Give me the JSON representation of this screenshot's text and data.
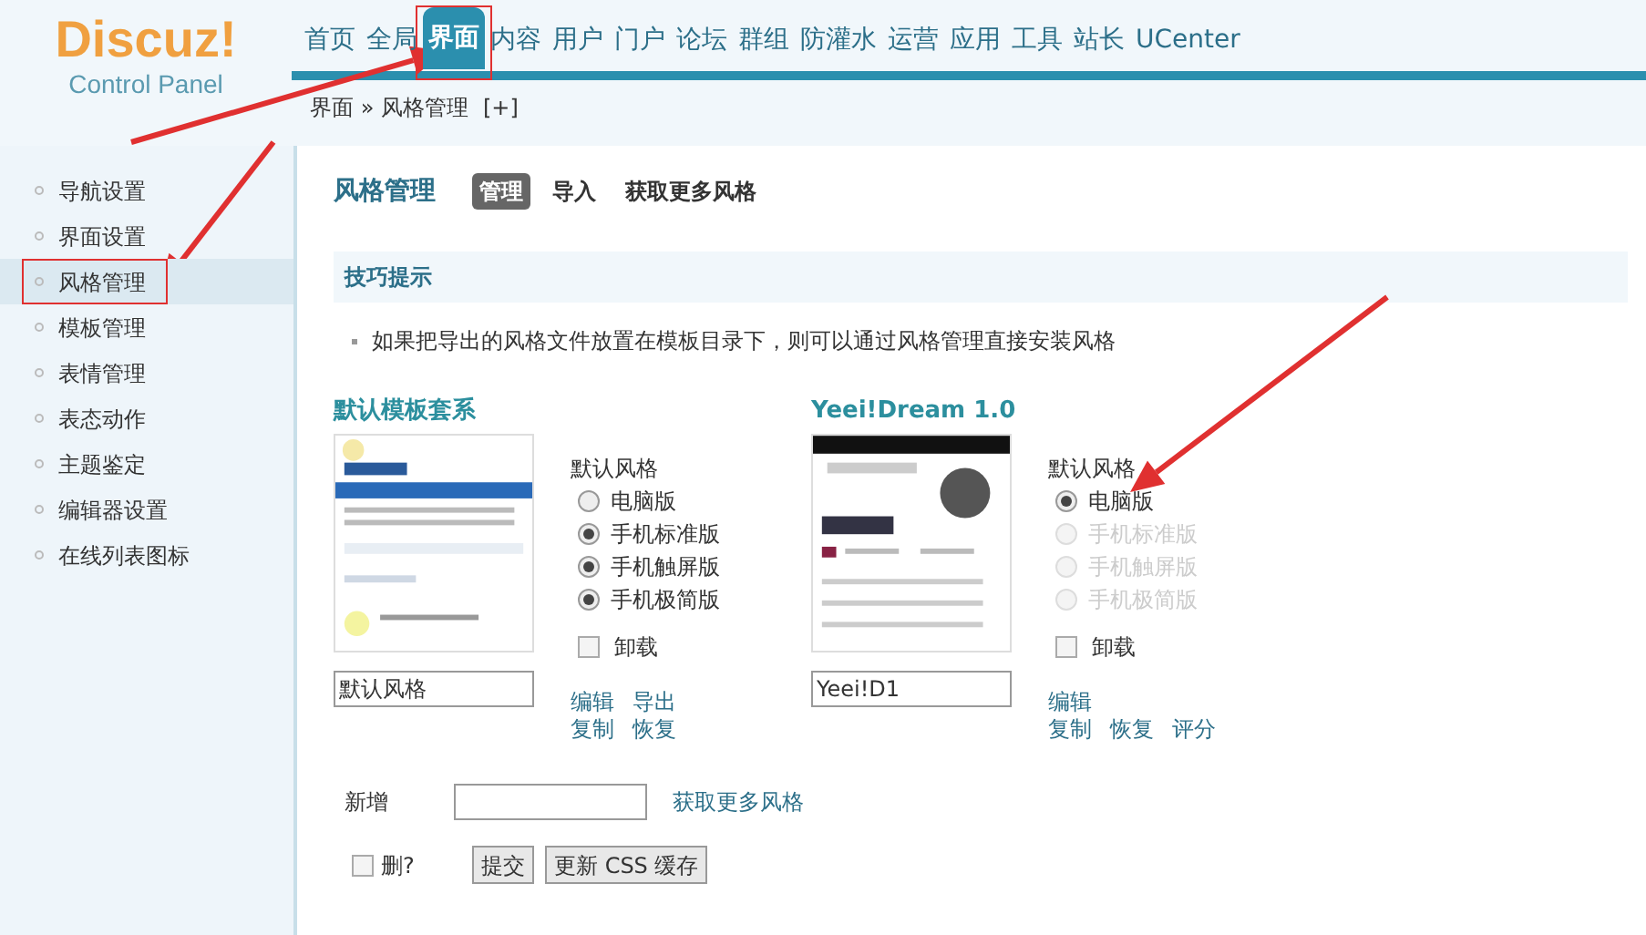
{
  "logo": {
    "title": "Discuz!",
    "subtitle": "Control Panel"
  },
  "nav": [
    {
      "label": "首页",
      "selected": false,
      "annotated": false
    },
    {
      "label": "全局",
      "selected": false,
      "annotated": false
    },
    {
      "label": "界面",
      "selected": true,
      "annotated": true
    },
    {
      "label": "内容",
      "selected": false,
      "annotated": false
    },
    {
      "label": "用户",
      "selected": false,
      "annotated": false
    },
    {
      "label": "门户",
      "selected": false,
      "annotated": false
    },
    {
      "label": "论坛",
      "selected": false,
      "annotated": false
    },
    {
      "label": "群组",
      "selected": false,
      "annotated": false
    },
    {
      "label": "防灌水",
      "selected": false,
      "annotated": false
    },
    {
      "label": "运营",
      "selected": false,
      "annotated": false
    },
    {
      "label": "应用",
      "selected": false,
      "annotated": false
    },
    {
      "label": "工具",
      "selected": false,
      "annotated": false
    },
    {
      "label": "站长",
      "selected": false,
      "annotated": false
    },
    {
      "label": "UCenter",
      "selected": false,
      "annotated": false
    }
  ],
  "breadcrumb": {
    "path": "界面 » 风格管理",
    "add": "[+]"
  },
  "sidebar": {
    "items": [
      {
        "label": "导航设置",
        "selected": false,
        "annotated": false
      },
      {
        "label": "界面设置",
        "selected": false,
        "annotated": false
      },
      {
        "label": "风格管理",
        "selected": true,
        "annotated": true
      },
      {
        "label": "模板管理",
        "selected": false,
        "annotated": false
      },
      {
        "label": "表情管理",
        "selected": false,
        "annotated": false
      },
      {
        "label": "表态动作",
        "selected": false,
        "annotated": false
      },
      {
        "label": "主题鉴定",
        "selected": false,
        "annotated": false
      },
      {
        "label": "编辑器设置",
        "selected": false,
        "annotated": false
      },
      {
        "label": "在线列表图标",
        "selected": false,
        "annotated": false
      }
    ]
  },
  "page": {
    "title": "风格管理",
    "tabs": [
      {
        "label": "管理",
        "selected": true
      },
      {
        "label": "导入",
        "selected": false
      },
      {
        "label": "获取更多风格",
        "selected": false
      }
    ]
  },
  "tips": {
    "title": "技巧提示",
    "items": [
      "如果把导出的风格文件放置在模板目录下，则可以通过风格管理直接安装风格"
    ]
  },
  "styles": [
    {
      "name": "默认模板套系",
      "default_label": "默认风格",
      "options": [
        {
          "label": "电脑版",
          "selected": false,
          "disabled": false
        },
        {
          "label": "手机标准版",
          "selected": true,
          "disabled": false
        },
        {
          "label": "手机触屏版",
          "selected": true,
          "disabled": false
        },
        {
          "label": "手机极简版",
          "selected": true,
          "disabled": false
        }
      ],
      "uninstall": {
        "label": "卸载",
        "checked": false
      },
      "value": "默认风格",
      "actions": [
        [
          "编辑",
          "导出"
        ],
        [
          "复制",
          "恢复"
        ]
      ]
    },
    {
      "name": "Yeei!Dream 1.0",
      "default_label": "默认风格",
      "options": [
        {
          "label": "电脑版",
          "selected": true,
          "disabled": false
        },
        {
          "label": "手机标准版",
          "selected": false,
          "disabled": true
        },
        {
          "label": "手机触屏版",
          "selected": false,
          "disabled": true
        },
        {
          "label": "手机极简版",
          "selected": false,
          "disabled": true
        }
      ],
      "uninstall": {
        "label": "卸载",
        "checked": false
      },
      "value": "Yeei!D1",
      "actions": [
        [
          "编辑"
        ],
        [
          "复制",
          "恢复",
          "评分"
        ]
      ]
    }
  ],
  "add": {
    "label": "新增",
    "link": "获取更多风格"
  },
  "footer": {
    "delete": {
      "label": "删?",
      "checked": false
    },
    "buttons": [
      "提交",
      "更新 CSS 缓存"
    ]
  }
}
